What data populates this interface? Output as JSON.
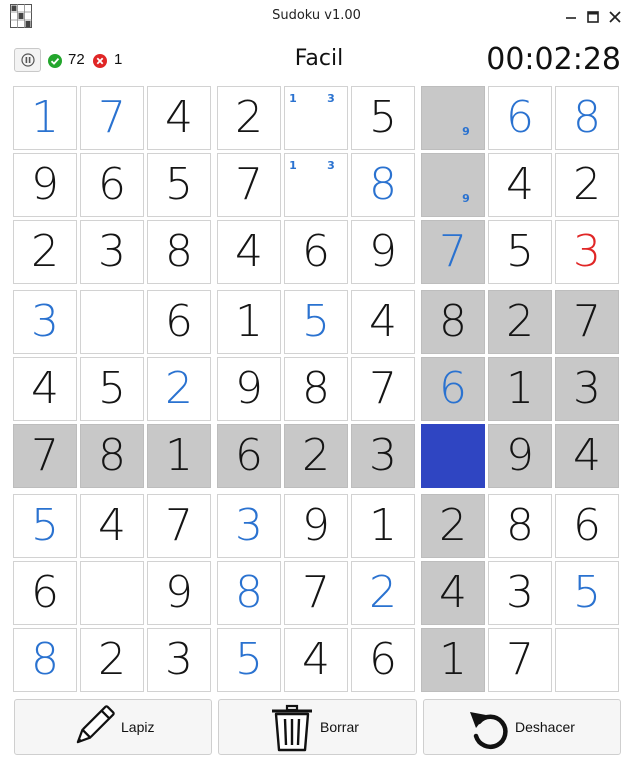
{
  "window": {
    "title": "Sudoku v1.00"
  },
  "header": {
    "correct_count": "72",
    "error_count": "1",
    "difficulty": "Facil",
    "timer": "00:02:28"
  },
  "colors": {
    "given": "#151515",
    "user_entry": "#2a72d0",
    "wrong_entry": "#e02626",
    "highlight": "#c8c8c8",
    "selected": "#2f45c2"
  },
  "board": {
    "rows": [
      [
        "1",
        "7",
        "4",
        "2",
        "",
        "5",
        "",
        "6",
        "8"
      ],
      [
        "9",
        "6",
        "5",
        "7",
        "",
        "8",
        "",
        "4",
        "2"
      ],
      [
        "2",
        "3",
        "8",
        "4",
        "6",
        "9",
        "7",
        "5",
        "3"
      ],
      [
        "3",
        "",
        "6",
        "1",
        "5",
        "4",
        "8",
        "2",
        "7"
      ],
      [
        "4",
        "5",
        "2",
        "9",
        "8",
        "7",
        "6",
        "1",
        "3"
      ],
      [
        "7",
        "8",
        "1",
        "6",
        "2",
        "3",
        "",
        "9",
        "4"
      ],
      [
        "5",
        "4",
        "7",
        "3",
        "9",
        "1",
        "2",
        "8",
        "6"
      ],
      [
        "6",
        "",
        "9",
        "8",
        "7",
        "2",
        "4",
        "3",
        "5"
      ],
      [
        "8",
        "2",
        "3",
        "5",
        "4",
        "6",
        "1",
        "7",
        ""
      ]
    ],
    "kinds": [
      [
        "u",
        "u",
        "g",
        "g",
        "n",
        "g",
        "n",
        "u",
        "u"
      ],
      [
        "g",
        "g",
        "g",
        "g",
        "n",
        "u",
        "n",
        "g",
        "g"
      ],
      [
        "g",
        "g",
        "g",
        "g",
        "g",
        "g",
        "u",
        "g",
        "w"
      ],
      [
        "u",
        "e",
        "g",
        "g",
        "u",
        "g",
        "g",
        "g",
        "g"
      ],
      [
        "g",
        "g",
        "u",
        "g",
        "g",
        "g",
        "u",
        "g",
        "g"
      ],
      [
        "g",
        "g",
        "g",
        "g",
        "g",
        "g",
        "s",
        "g",
        "g"
      ],
      [
        "u",
        "g",
        "g",
        "u",
        "g",
        "g",
        "g",
        "g",
        "g"
      ],
      [
        "g",
        "e",
        "g",
        "u",
        "g",
        "u",
        "g",
        "g",
        "u"
      ],
      [
        "u",
        "g",
        "g",
        "u",
        "g",
        "g",
        "g",
        "g",
        "e"
      ]
    ],
    "highlighted": [
      [
        0,
        6
      ],
      [
        1,
        6
      ],
      [
        2,
        6
      ],
      [
        3,
        6
      ],
      [
        4,
        6
      ],
      [
        6,
        6
      ],
      [
        7,
        6
      ],
      [
        8,
        6
      ],
      [
        5,
        0
      ],
      [
        5,
        1
      ],
      [
        5,
        2
      ],
      [
        5,
        3
      ],
      [
        5,
        4
      ],
      [
        5,
        5
      ],
      [
        5,
        7
      ],
      [
        5,
        8
      ],
      [
        3,
        7
      ],
      [
        3,
        8
      ],
      [
        4,
        7
      ],
      [
        4,
        8
      ]
    ],
    "selected": [
      5,
      6
    ],
    "notes": [
      {
        "row": 0,
        "col": 4,
        "digits": [
          "1",
          "3"
        ]
      },
      {
        "row": 1,
        "col": 4,
        "digits": [
          "1",
          "3"
        ]
      },
      {
        "row": 0,
        "col": 6,
        "digits": [
          "9"
        ]
      },
      {
        "row": 1,
        "col": 6,
        "digits": [
          "9"
        ]
      }
    ]
  },
  "toolbar": {
    "pencil_label": "Lapiz",
    "erase_label": "Borrar",
    "undo_label": "Deshacer"
  },
  "icons": {
    "app": "sudoku-grid-icon",
    "pause": "pause-icon",
    "correct": "check-circle-icon",
    "errors": "x-circle-icon",
    "pencil": "pencil-icon",
    "erase": "trash-icon",
    "undo": "undo-icon"
  }
}
